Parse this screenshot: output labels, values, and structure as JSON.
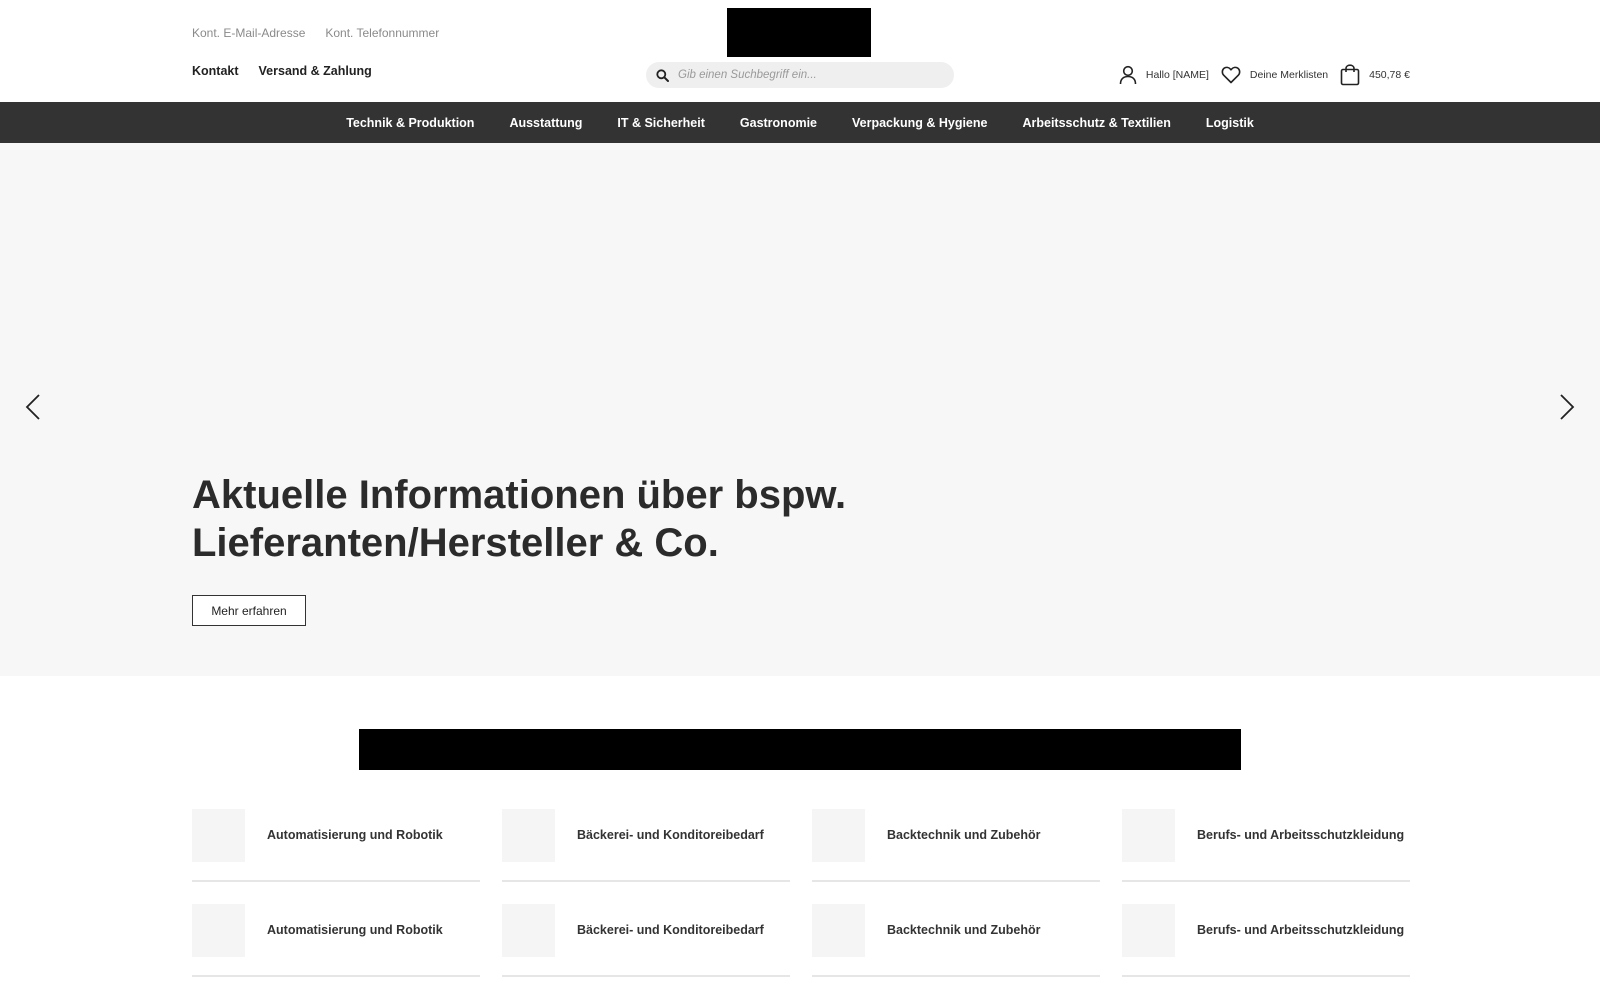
{
  "header": {
    "contact": {
      "email_label": "Kont. E-Mail-Adresse",
      "phone_label": "Kont. Telefonnummer"
    },
    "service_links": [
      {
        "label": "Kontakt"
      },
      {
        "label": "Versand & Zahlung"
      }
    ],
    "search": {
      "placeholder": "Gib einen Suchbegriff ein...",
      "icon": "search-icon"
    },
    "account": {
      "greeting": "Hallo [NAME]",
      "icon": "user-icon"
    },
    "wishlist": {
      "label": "Deine Merklisten",
      "icon": "heart-icon"
    },
    "cart": {
      "total": "450,78 €",
      "icon": "shopping-bag-icon"
    }
  },
  "nav": {
    "items": [
      {
        "label": "Technik & Produktion"
      },
      {
        "label": "Ausstattung"
      },
      {
        "label": "IT & Sicherheit"
      },
      {
        "label": "Gastronomie"
      },
      {
        "label": "Verpackung & Hygiene"
      },
      {
        "label": "Arbeitsschutz & Textilien"
      },
      {
        "label": "Logistik"
      }
    ]
  },
  "hero": {
    "title_line1": "Aktuelle Informationen über bspw.",
    "title_line2": "Lieferanten/Hersteller & Co.",
    "button_label": "Mehr erfahren",
    "prev_icon": "chevron-left-icon",
    "next_icon": "chevron-right-icon"
  },
  "categories": [
    {
      "label": "Automatisierung und Robotik"
    },
    {
      "label": "Bäckerei- und Konditoreibedarf"
    },
    {
      "label": "Backtechnik und Zubehör"
    },
    {
      "label": "Berufs- und Arbeitsschutzkleidung"
    },
    {
      "label": "Automatisierung und Robotik"
    },
    {
      "label": "Bäckerei- und Konditoreibedarf"
    },
    {
      "label": "Backtechnik und Zubehör"
    },
    {
      "label": "Berufs- und Arbeitsschutzkleidung"
    }
  ],
  "colors": {
    "nav_background": "#333333",
    "hero_background": "#f7f7f7",
    "text": "#222222",
    "muted_text": "#8a8a8a"
  }
}
